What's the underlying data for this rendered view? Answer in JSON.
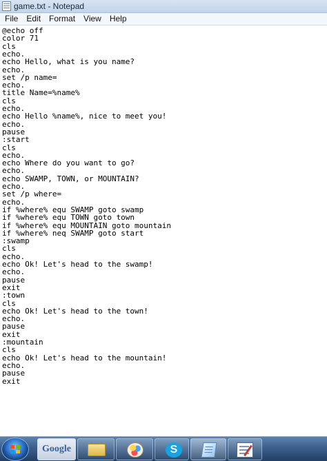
{
  "window": {
    "title": "game.txt - Notepad",
    "icon": "notepad-icon"
  },
  "menu": {
    "items": [
      "File",
      "Edit",
      "Format",
      "View",
      "Help"
    ]
  },
  "editor": {
    "lines": [
      "@echo off",
      "color 71",
      "cls",
      "echo.",
      "echo Hello, what is you name?",
      "echo.",
      "set /p name=",
      "echo.",
      "title Name=%name%",
      "cls",
      "echo.",
      "echo Hello %name%, nice to meet you!",
      "echo.",
      "pause",
      ":start",
      "cls",
      "echo.",
      "echo Where do you want to go?",
      "echo.",
      "echo SWAMP, TOWN, or MOUNTAIN?",
      "echo.",
      "set /p where=",
      "echo.",
      "if %where% equ SWAMP goto swamp",
      "if %where% equ TOWN goto town",
      "if %where% equ MOUNTAIN goto mountain",
      "if %where% neq SWAMP goto start",
      ":swamp",
      "cls",
      "echo.",
      "echo Ok! Let's head to the swamp!",
      "echo.",
      "pause",
      "exit",
      ":town",
      "cls",
      "echo Ok! Let's head to the town!",
      "echo.",
      "pause",
      "exit",
      ":mountain",
      "cls",
      "echo Ok! Let's head to the mountain!",
      "echo.",
      "pause",
      "exit"
    ]
  },
  "taskbar": {
    "google_label": "Google",
    "skype_glyph": "S",
    "items": [
      "start-button",
      "google-button",
      "folder-icon",
      "paint-icon",
      "skype-icon",
      "notepad-icon",
      "editor-icon"
    ]
  }
}
